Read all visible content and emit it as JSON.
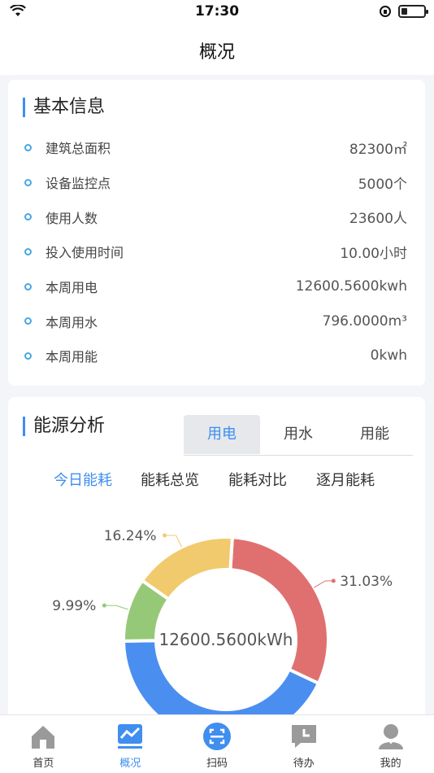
{
  "status_bar": {
    "time": "17:30"
  },
  "nav": {
    "title": "概况"
  },
  "basic_info": {
    "title": "基本信息",
    "rows": [
      {
        "label": "建筑总面积",
        "value": "82300㎡"
      },
      {
        "label": "设备监控点",
        "value": "5000个"
      },
      {
        "label": "使用人数",
        "value": "23600人"
      },
      {
        "label": "投入使用时间",
        "value": "10.00小时"
      },
      {
        "label": "本周用电",
        "value": "12600.5600kwh"
      },
      {
        "label": "本周用水",
        "value": "796.0000m³"
      },
      {
        "label": "本周用能",
        "value": "0kwh"
      }
    ]
  },
  "energy": {
    "title": "能源分析",
    "segments": [
      "用电",
      "用水",
      "用能"
    ],
    "active_segment": 0,
    "subtabs": [
      "今日能耗",
      "能耗总览",
      "能耗对比",
      "逐月能耗"
    ],
    "active_subtab": 0
  },
  "chart_data": {
    "type": "pie",
    "center_label": "12600.5600kWh",
    "slices": [
      {
        "label": "31.03%",
        "value": 31.03,
        "color": "#e07070"
      },
      {
        "label": "",
        "value": 42.74,
        "color": "#4a8ef0"
      },
      {
        "label": "9.99%",
        "value": 9.99,
        "color": "#96c977"
      },
      {
        "label": "16.24%",
        "value": 16.24,
        "color": "#f1ca6d"
      }
    ]
  },
  "tabbar": {
    "items": [
      {
        "label": "首页",
        "icon": "home-icon"
      },
      {
        "label": "概况",
        "icon": "chart-icon"
      },
      {
        "label": "扫码",
        "icon": "scan-icon"
      },
      {
        "label": "待办",
        "icon": "todo-icon"
      },
      {
        "label": "我的",
        "icon": "profile-icon"
      }
    ],
    "active": 1
  }
}
